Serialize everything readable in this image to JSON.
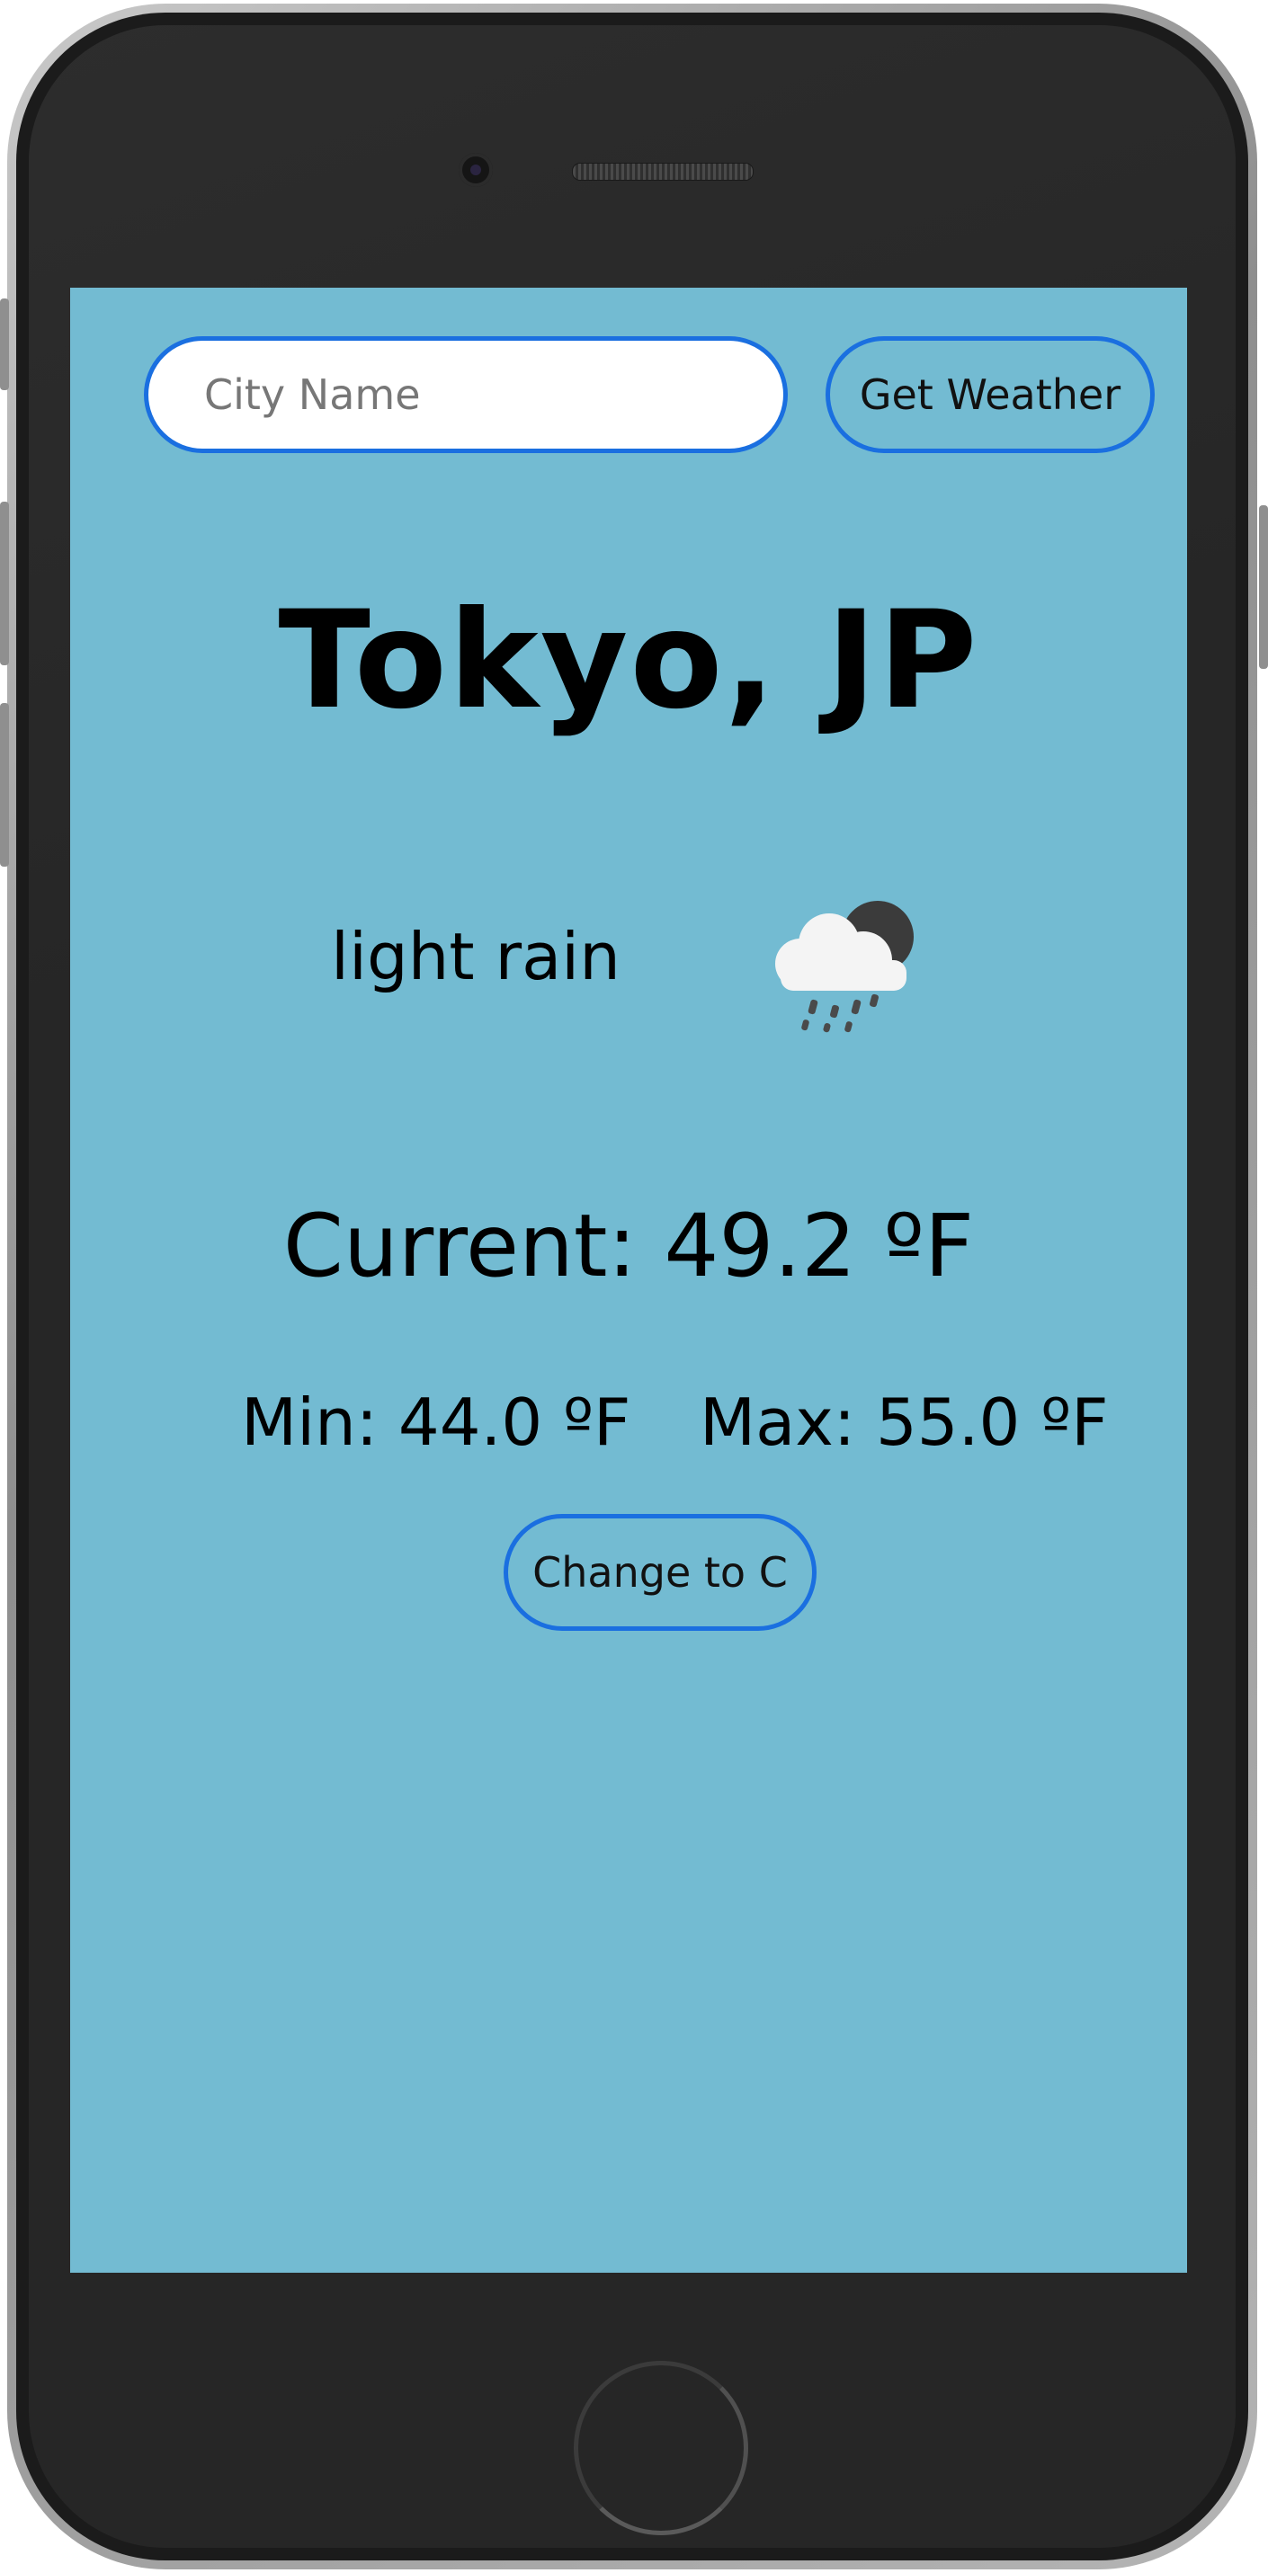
{
  "search": {
    "placeholder": "City Name",
    "value": "",
    "button_label": "Get Weather"
  },
  "weather": {
    "city": "Tokyo, JP",
    "description": "light rain",
    "icon": "night-rain-cloud-icon",
    "current_text": "Current: 49.2 ºF",
    "min_text": "Min: 44.0 ºF",
    "max_text": "Max: 55.0 ºF",
    "unit_toggle_label": "Change to C"
  },
  "colors": {
    "screen_background": "#73bbd2",
    "accent_border": "#1a6fe0",
    "phone_body": "#262626"
  }
}
